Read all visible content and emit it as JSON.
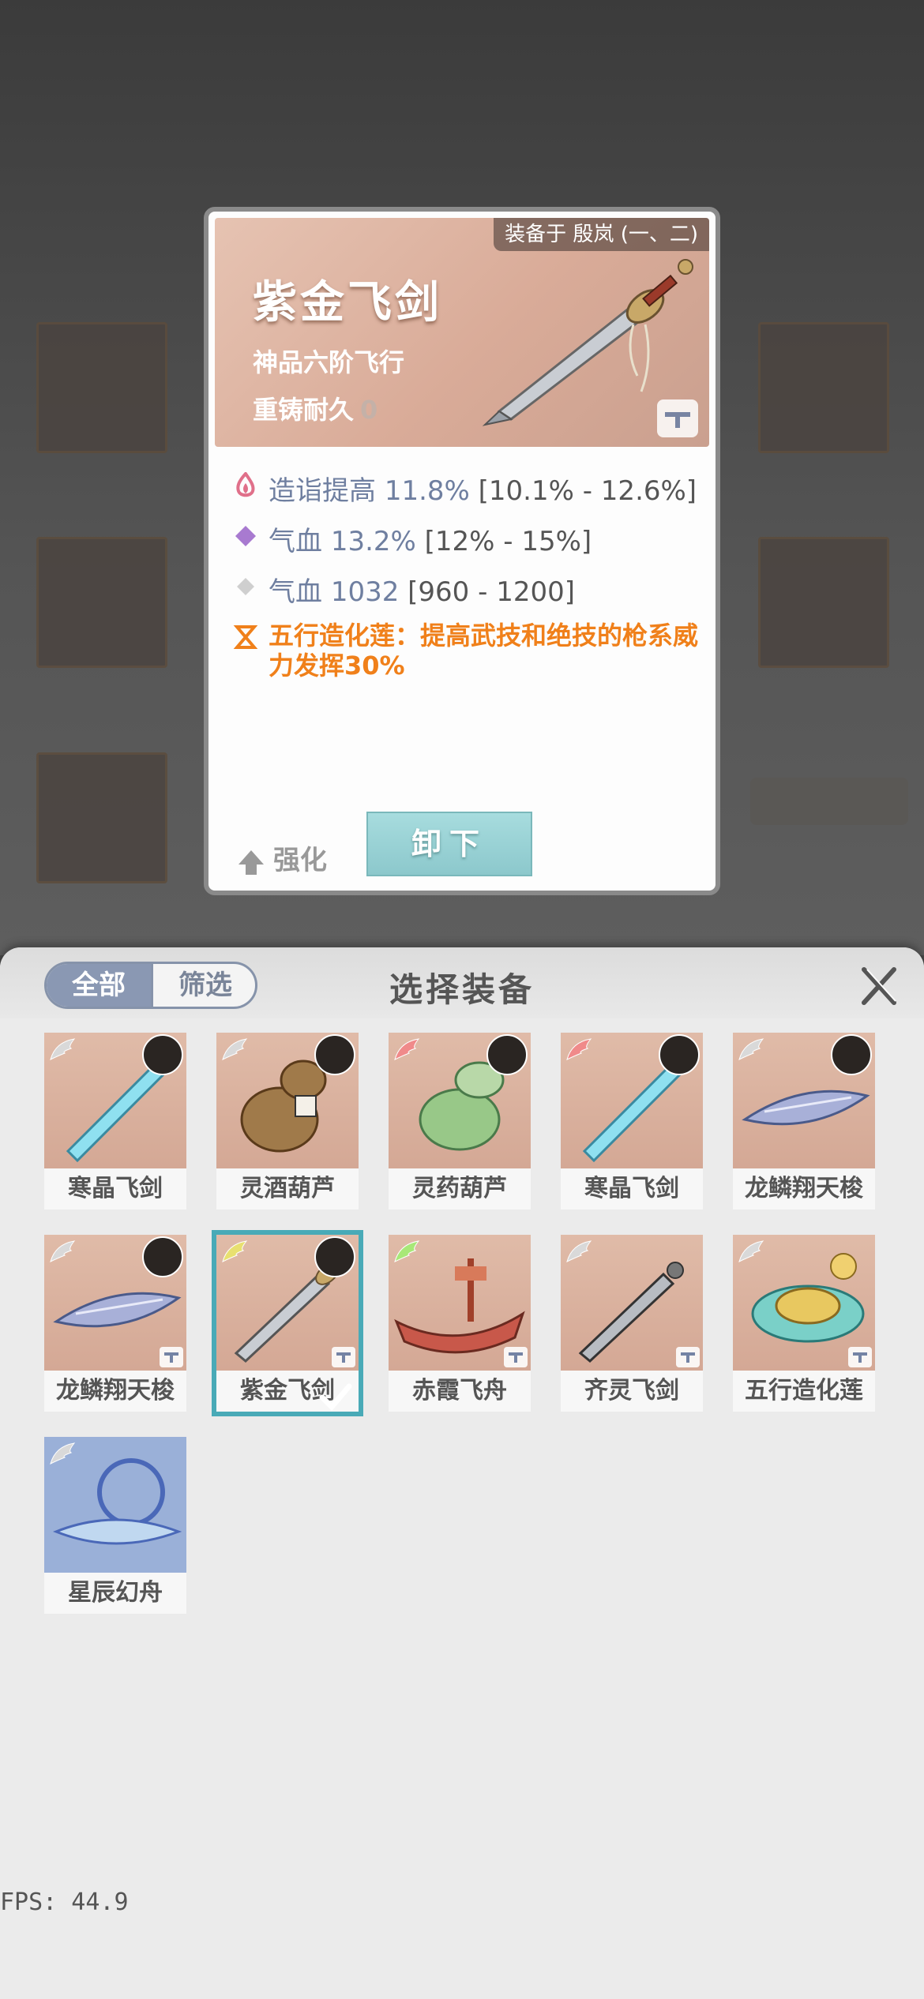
{
  "detail": {
    "equipped_by": "装备于 殷岚 (一、二)",
    "title": "紫金飞剑",
    "subtitle": "神品六阶飞行",
    "reforge_label": "重铸耐久",
    "reforge_value": "0",
    "stats": [
      {
        "name": "造诣提高",
        "value": "11.8%",
        "range": "[10.1% - 12.6%]",
        "icon": "flame-icon",
        "color": "#e0708a"
      },
      {
        "name": "气血",
        "value": "13.2%",
        "range": "[12% - 15%]",
        "icon": "diamond-icon",
        "color": "#a87ad0"
      },
      {
        "name": "气血",
        "value": "1032",
        "range": "[960 - 1200]",
        "icon": "diamond-icon",
        "color": "#c8c8c8"
      }
    ],
    "effect": "五行造化莲：提高武技和绝技的枪系威力发挥30%",
    "enhance_label": "强化",
    "unequip_label": "卸下"
  },
  "sheet": {
    "tab_all": "全部",
    "tab_filter": "筛选",
    "title": "选择装备",
    "items": [
      {
        "name": "寒晶飞剑",
        "art": "sword-ice",
        "wing": "#d9d9d9",
        "avatar": true,
        "lock": false,
        "selected": false
      },
      {
        "name": "灵酒葫芦",
        "art": "gourd-wine",
        "wing": "#d9d9d9",
        "avatar": true,
        "lock": false,
        "selected": false
      },
      {
        "name": "灵药葫芦",
        "art": "gourd-herb",
        "wing": "#f08a8a",
        "avatar": true,
        "lock": false,
        "selected": false
      },
      {
        "name": "寒晶飞剑",
        "art": "sword-ice",
        "wing": "#f08a8a",
        "avatar": true,
        "lock": false,
        "selected": false
      },
      {
        "name": "龙鳞翔天梭",
        "art": "shuttle",
        "wing": "#d9d9d9",
        "avatar": true,
        "lock": false,
        "selected": false
      },
      {
        "name": "龙鳞翔天梭",
        "art": "shuttle",
        "wing": "#d9d9d9",
        "avatar": true,
        "lock": true,
        "selected": false
      },
      {
        "name": "紫金飞剑",
        "art": "sword-gold",
        "wing": "#e8e070",
        "avatar": true,
        "lock": true,
        "selected": true
      },
      {
        "name": "赤霞飞舟",
        "art": "boat",
        "wing": "#a8e878",
        "avatar": false,
        "lock": true,
        "selected": false
      },
      {
        "name": "齐灵飞剑",
        "art": "sword-dark",
        "wing": "#d9d9d9",
        "avatar": false,
        "lock": true,
        "selected": false
      },
      {
        "name": "五行造化莲",
        "art": "lotus",
        "wing": "#d9d9d9",
        "avatar": false,
        "lock": true,
        "selected": false
      },
      {
        "name": "星辰幻舟",
        "art": "star-boat",
        "wing": "#d9d9d9",
        "avatar": false,
        "lock": false,
        "selected": false
      }
    ]
  },
  "fps": "FPS: 44.9",
  "colors": {
    "accent": "#49aab7",
    "effect": "#f0801a",
    "stat_value": "#6f7fa0"
  }
}
